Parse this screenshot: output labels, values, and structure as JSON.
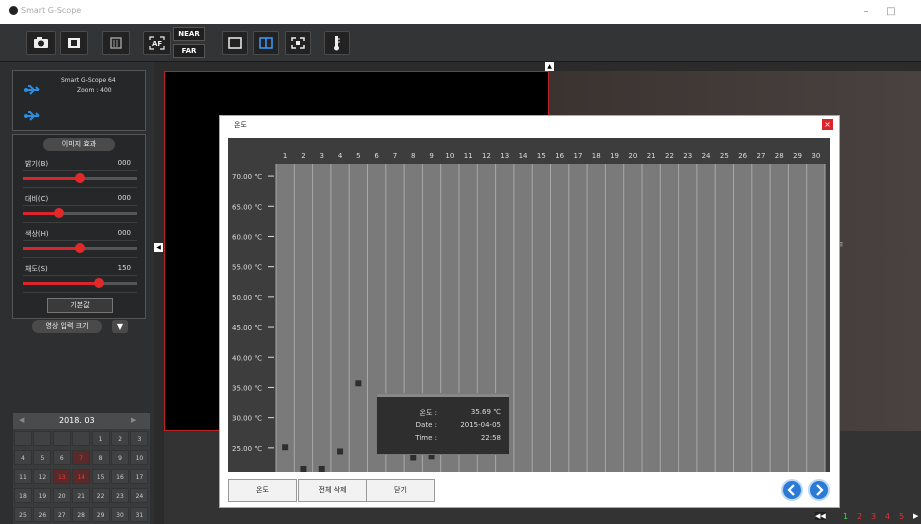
{
  "app": {
    "title": "Smart G-Scope"
  },
  "toolbar": {
    "near_label": "NEAR",
    "far_label": "FAR",
    "af_label": "AF"
  },
  "device": {
    "name": "Smart G-Scope 64",
    "zoom": "Zoom : 400"
  },
  "image_effects": {
    "header": "이미지 효과",
    "sliders": [
      {
        "label": "밝기(B)",
        "value": "000",
        "level": 0.5
      },
      {
        "label": "대비(C)",
        "value": "000",
        "level": 0.32
      },
      {
        "label": "색상(H)",
        "value": "000",
        "level": 0.5
      },
      {
        "label": "채도(S)",
        "value": "150",
        "level": 0.67
      }
    ],
    "default_button": "기본값"
  },
  "video_size": {
    "label": "영상 입력 크기"
  },
  "calendar": {
    "month": "2018. 03",
    "rows": [
      [
        "",
        "",
        "",
        "",
        "1",
        "2",
        "3"
      ],
      [
        "4",
        "5",
        "6",
        "7",
        "8",
        "9",
        "10"
      ],
      [
        "11",
        "12",
        "13",
        "14",
        "15",
        "16",
        "17"
      ],
      [
        "18",
        "19",
        "20",
        "21",
        "22",
        "23",
        "24"
      ],
      [
        "25",
        "26",
        "27",
        "28",
        "29",
        "30",
        "31"
      ]
    ],
    "highlight": [
      "7",
      "13",
      "14"
    ]
  },
  "dialog": {
    "title": "온도",
    "buttons": {
      "temp": "온도",
      "delete_all": "전체 삭제",
      "close": "닫기"
    }
  },
  "tooltip": {
    "temp_label": "온도 :",
    "temp_value": "35.69 ℃",
    "date_label": "Date :",
    "date_value": "2015-04-05",
    "time_label": "Time :",
    "time_value": "22:58"
  },
  "pager": {
    "pages": [
      "1",
      "2",
      "3",
      "4",
      "5"
    ],
    "arrow_left": "◀◀",
    "arrow_right": "▶"
  },
  "colors": {
    "accent_red": "#d9252b",
    "accent_blue": "#2b7bd6",
    "point": "#2e2e2e",
    "plot_bg": "#7a7a7a"
  },
  "chart_data": {
    "type": "scatter",
    "x_ticks": [
      "1",
      "2",
      "3",
      "4",
      "5",
      "6",
      "7",
      "8",
      "9",
      "10",
      "11",
      "12",
      "13",
      "14",
      "15",
      "16",
      "17",
      "18",
      "19",
      "20",
      "21",
      "22",
      "23",
      "24",
      "25",
      "26",
      "27",
      "28",
      "29",
      "30"
    ],
    "y_ticks": [
      "70.00 ℃",
      "65.00 ℃",
      "60.00 ℃",
      "55.00 ℃",
      "50.00 ℃",
      "45.00 ℃",
      "40.00 ℃",
      "35.00 ℃",
      "30.00 ℃",
      "25.00 ℃"
    ],
    "ylim": [
      21,
      72
    ],
    "grid": true,
    "points": [
      {
        "x": 1,
        "y": 25.1
      },
      {
        "x": 2,
        "y": 21.5
      },
      {
        "x": 3,
        "y": 21.5
      },
      {
        "x": 4,
        "y": 24.4
      },
      {
        "x": 5,
        "y": 35.69
      },
      {
        "x": 8,
        "y": 23.4
      },
      {
        "x": 9,
        "y": 23.6
      }
    ]
  }
}
